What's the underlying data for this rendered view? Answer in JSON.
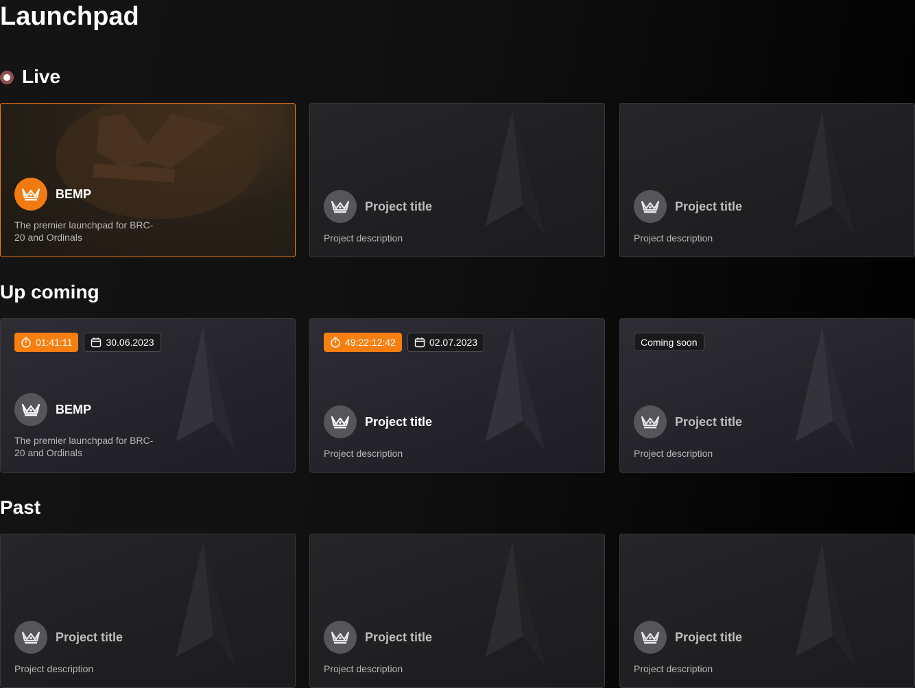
{
  "page": {
    "title": "Launchpad"
  },
  "sections": {
    "live": {
      "title": "Live"
    },
    "upcoming": {
      "title": "Up coming"
    },
    "past": {
      "title": "Past"
    }
  },
  "live_cards": [
    {
      "title": "BEMP",
      "description": "The premier launchpad for BRC-20 and Ordinals",
      "icon": "bemp-crown-icon",
      "highlight": true
    },
    {
      "title": "Project title",
      "description": "Project description",
      "icon": "crown-icon"
    },
    {
      "title": "Project title",
      "description": "Project description",
      "icon": "crown-icon"
    }
  ],
  "upcoming_cards": [
    {
      "countdown": "01:41:11",
      "date": "30.06.2023",
      "title": "BEMP",
      "description": "The premier launchpad for BRC-20 and Ordinals"
    },
    {
      "countdown": "49:22:12:42",
      "date": "02.07.2023",
      "title": "Project title",
      "description": "Project description"
    },
    {
      "status": "Coming soon",
      "title": "Project title",
      "description": "Project description"
    }
  ],
  "past_cards": [
    {
      "title": "Project title",
      "description": "Project description"
    },
    {
      "title": "Project title",
      "description": "Project description"
    },
    {
      "title": "Project title",
      "description": "Project description"
    }
  ],
  "colors": {
    "accent": "#f27a11",
    "background": "#0e0e0e",
    "card": "#232326",
    "live_dot": "#8d4f4f"
  },
  "icons": {
    "timer": "stopwatch-icon",
    "date": "calendar-icon",
    "live": "live-indicator-icon"
  }
}
